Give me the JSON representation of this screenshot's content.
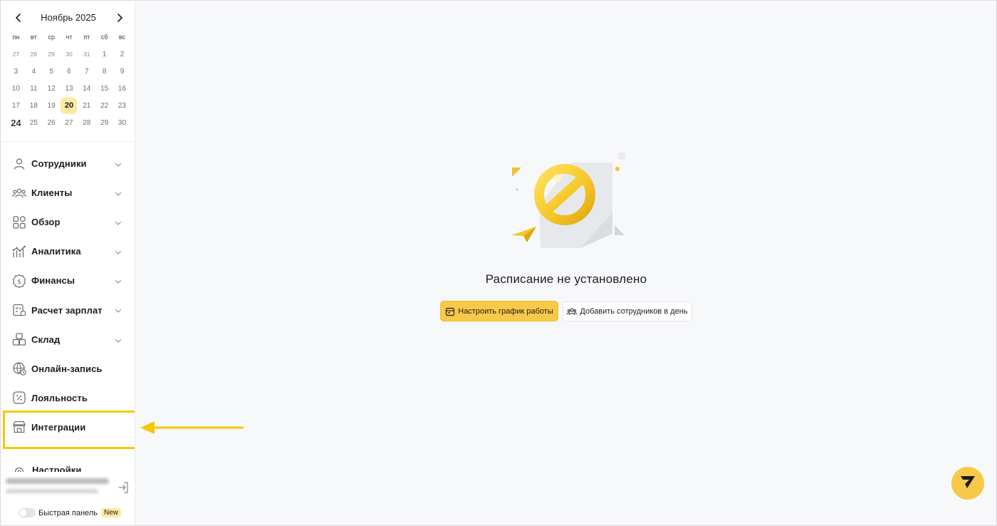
{
  "calendar": {
    "month_title": "Ноябрь 2025",
    "weekdays": [
      "пн",
      "вт",
      "ср",
      "чт",
      "пт",
      "сб",
      "вс"
    ],
    "weeks": [
      [
        "27",
        "28",
        "29",
        "30",
        "31",
        "1",
        "2"
      ],
      [
        "3",
        "4",
        "5",
        "6",
        "7",
        "8",
        "9"
      ],
      [
        "10",
        "11",
        "12",
        "13",
        "14",
        "15",
        "16"
      ],
      [
        "17",
        "18",
        "19",
        "20",
        "21",
        "22",
        "23"
      ],
      [
        "24",
        "25",
        "26",
        "27",
        "28",
        "29",
        "30"
      ]
    ],
    "today": "20"
  },
  "nav": {
    "items": [
      {
        "label": "Сотрудники",
        "icon": "user-icon",
        "has_chevron": true
      },
      {
        "label": "Клиенты",
        "icon": "users-icon",
        "has_chevron": true
      },
      {
        "label": "Обзор",
        "icon": "grid-icon",
        "has_chevron": true
      },
      {
        "label": "Аналитика",
        "icon": "analytics-icon",
        "has_chevron": true
      },
      {
        "label": "Финансы",
        "icon": "dollar-icon",
        "has_chevron": true
      },
      {
        "label": "Расчет зарплат",
        "icon": "payroll-icon",
        "has_chevron": true
      },
      {
        "label": "Склад",
        "icon": "boxes-icon",
        "has_chevron": true
      },
      {
        "label": "Онлайн-запись",
        "icon": "globe-icon",
        "has_chevron": false
      },
      {
        "label": "Лояльность",
        "icon": "percent-icon",
        "has_chevron": false
      },
      {
        "label": "Интеграции",
        "icon": "store-icon",
        "has_chevron": false
      }
    ],
    "settings_label": "Настройки"
  },
  "quick_panel": {
    "label": "Быстрая панель",
    "badge": "New"
  },
  "main": {
    "empty_title": "Расписание не установлено",
    "primary_button": "Настроить график работы",
    "secondary_button": "Добавить сотрудников в день"
  },
  "colors": {
    "accent": "#f7c948",
    "highlight_border": "#f7c800",
    "today_bg": "#fde9a0"
  }
}
